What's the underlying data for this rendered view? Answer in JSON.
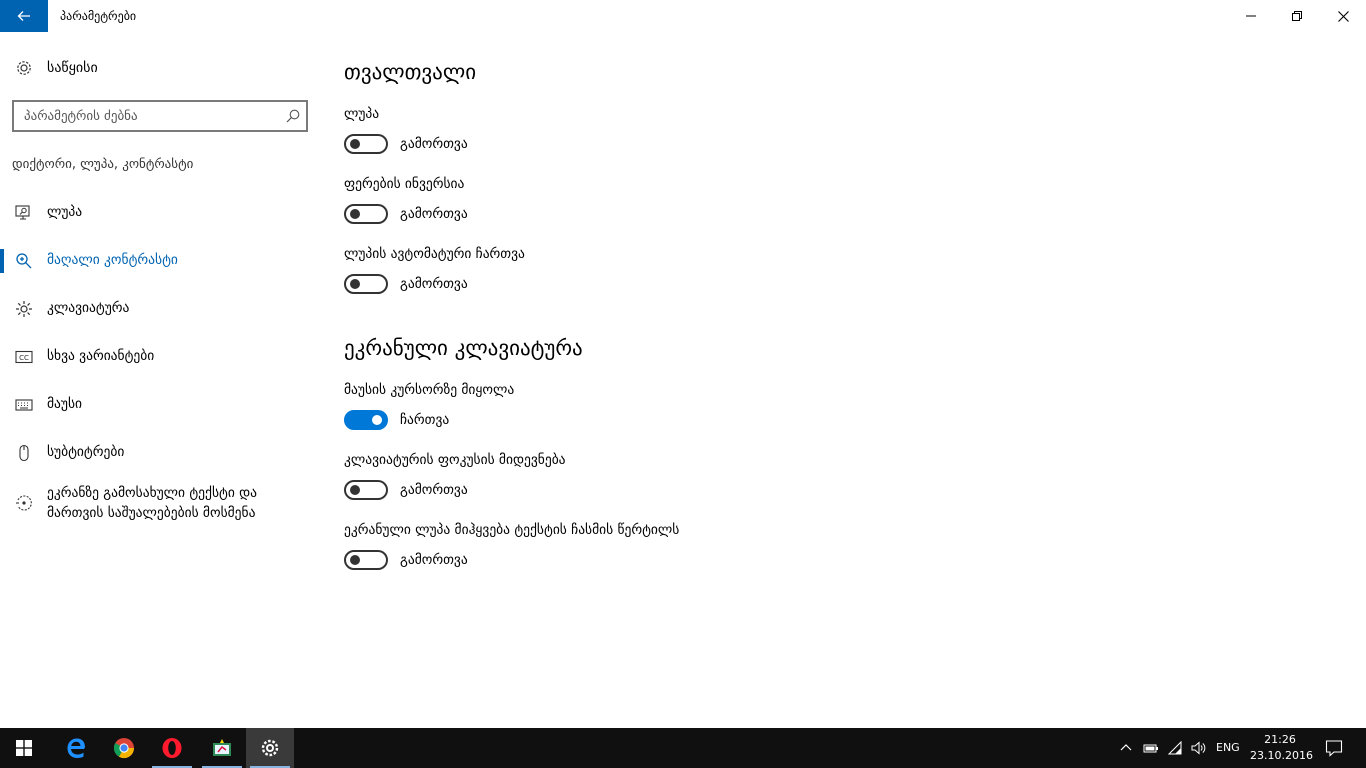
{
  "window": {
    "title": "პარამეტრები"
  },
  "sidebar": {
    "home_label": "საწყისი",
    "search_placeholder": "პარამეტრის ძებნა",
    "section_title": "დიქტორი, ლუპა, კონტრასტი",
    "items": [
      {
        "label": "ლუპა",
        "icon": "monitor-magnifier-icon",
        "active": false
      },
      {
        "label": "მაღალი კონტრასტი",
        "icon": "magnifier-icon",
        "active": true
      },
      {
        "label": "კლავიატურა",
        "icon": "brightness-icon",
        "active": false
      },
      {
        "label": "სხვა ვარიანტები",
        "icon": "closed-caption-icon",
        "active": false
      },
      {
        "label": "მაუსი",
        "icon": "keyboard-icon",
        "active": false
      },
      {
        "label": "სუბტიტრები",
        "icon": "mouse-icon",
        "active": false
      },
      {
        "label": "ეკრანზე გამოსახული ტექსტი და მართვის საშუალებების მოსმენა",
        "icon": "ease-of-access-icon",
        "active": false
      }
    ]
  },
  "content": {
    "sections": [
      {
        "heading": "თვალთვალი",
        "options": [
          {
            "label": "ლუპა",
            "state": "გამორთვა",
            "on": false
          },
          {
            "label": "ფერების ინვერსია",
            "state": "გამორთვა",
            "on": false
          },
          {
            "label": "ლუპის ავტომატური ჩართვა",
            "state": "გამორთვა",
            "on": false
          }
        ]
      },
      {
        "heading": "ეკრანული კლავიატურა",
        "options": [
          {
            "label": "მაუსის კურსორზე მიყოლა",
            "state": "ჩართვა",
            "on": true
          },
          {
            "label": "კლავიატურის ფოკუსის მიდევნება",
            "state": "გამორთვა",
            "on": false
          },
          {
            "label": "ეკრანული ლუპა მიჰყვება ტექსტის ჩასმის წერტილს",
            "state": "გამორთვა",
            "on": false
          }
        ]
      }
    ]
  },
  "taskbar": {
    "apps": [
      "start-icon",
      "edge-icon",
      "chrome-icon",
      "opera-icon",
      "app-icon",
      "settings-icon"
    ],
    "language": "ENG",
    "time": "21:26",
    "date": "23.10.2016"
  },
  "colors": {
    "accent": "#0063b1",
    "toggle_on": "#0078d7",
    "taskbar": "#101010"
  }
}
